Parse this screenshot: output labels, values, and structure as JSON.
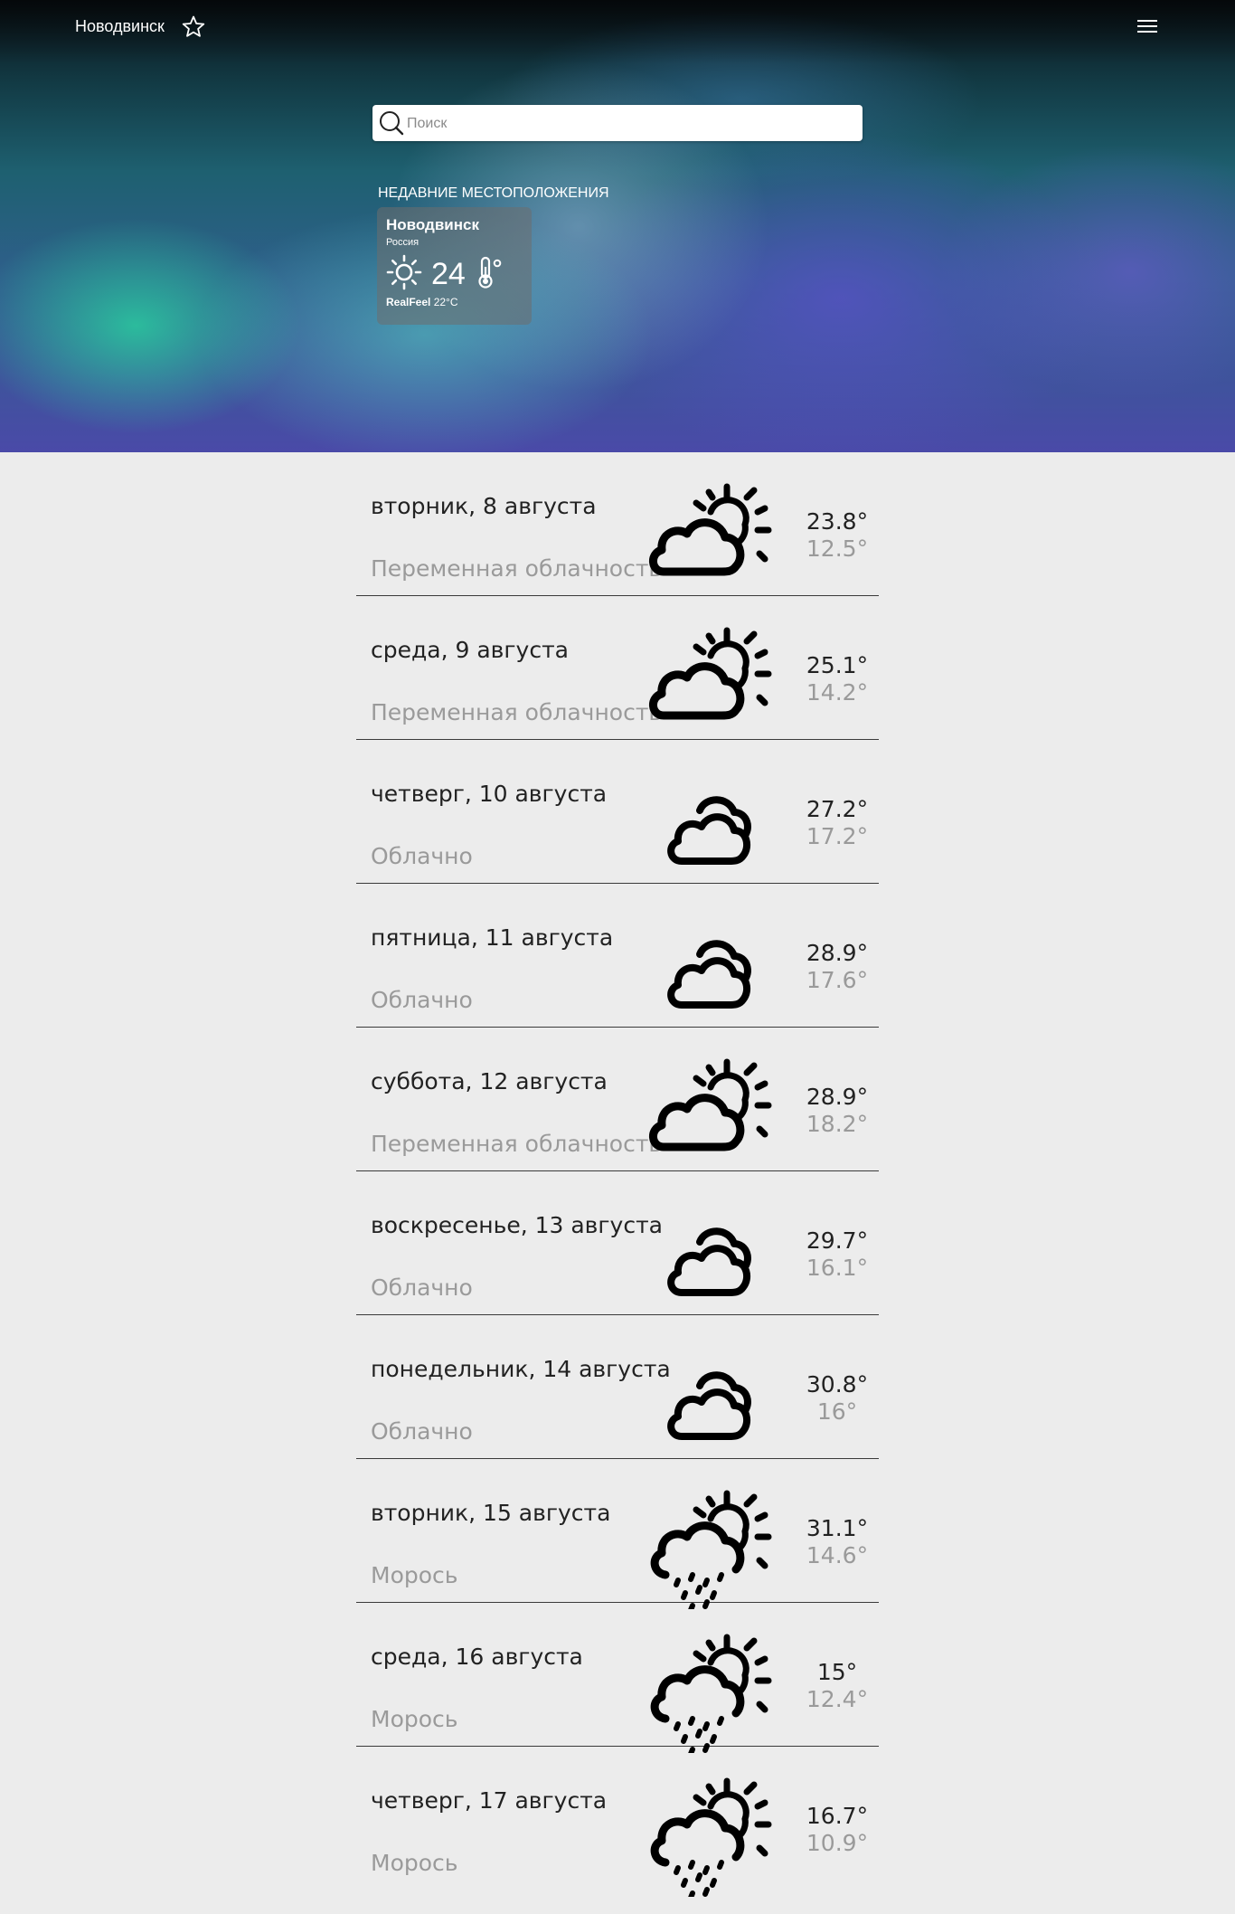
{
  "header": {
    "city": "Новодвинск"
  },
  "search": {
    "placeholder": "Поиск"
  },
  "recent": {
    "heading": "НЕДАВНИЕ МЕСТОПОЛОЖЕНИЯ",
    "card": {
      "city": "Новодвинск",
      "country": "Россия",
      "temp": "24",
      "realfeel_label": "RealFeel",
      "realfeel_value": "22°C",
      "icon": "sun-icon"
    }
  },
  "forecast": [
    {
      "date": "вторник, 8 августа",
      "condition": "Переменная облачность",
      "icon": "partly-cloudy",
      "high": "23.8°",
      "low": "12.5°"
    },
    {
      "date": "среда, 9 августа",
      "condition": "Переменная облачность",
      "icon": "partly-cloudy",
      "high": "25.1°",
      "low": "14.2°"
    },
    {
      "date": "четверг, 10 августа",
      "condition": "Облачно",
      "icon": "cloudy",
      "high": "27.2°",
      "low": "17.2°"
    },
    {
      "date": "пятница, 11 августа",
      "condition": "Облачно",
      "icon": "cloudy",
      "high": "28.9°",
      "low": "17.6°"
    },
    {
      "date": "суббота, 12 августа",
      "condition": "Переменная облачность",
      "icon": "partly-cloudy",
      "high": "28.9°",
      "low": "18.2°"
    },
    {
      "date": "воскресенье, 13 августа",
      "condition": "Облачно",
      "icon": "cloudy",
      "high": "29.7°",
      "low": "16.1°"
    },
    {
      "date": "понедельник, 14 августа",
      "condition": "Облачно",
      "icon": "cloudy",
      "high": "30.8°",
      "low": "16°"
    },
    {
      "date": "вторник, 15 августа",
      "condition": "Морось",
      "icon": "drizzle",
      "high": "31.1°",
      "low": "14.6°"
    },
    {
      "date": "среда, 16 августа",
      "condition": "Морось",
      "icon": "drizzle",
      "high": "15°",
      "low": "12.4°"
    },
    {
      "date": "четверг, 17 августа",
      "condition": "Морось",
      "icon": "drizzle",
      "high": "16.7°",
      "low": "10.9°"
    }
  ]
}
